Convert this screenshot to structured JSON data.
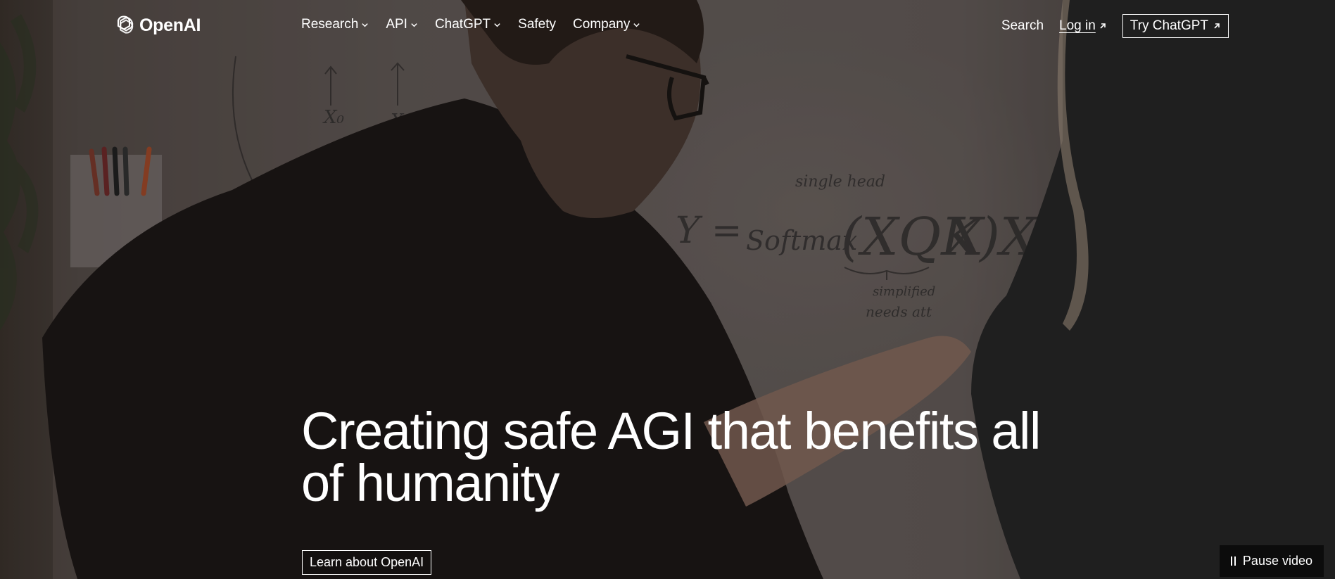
{
  "brand": {
    "name": "OpenAI"
  },
  "nav": {
    "items": [
      {
        "label": "Research",
        "has_dropdown": true
      },
      {
        "label": "API",
        "has_dropdown": true
      },
      {
        "label": "ChatGPT",
        "has_dropdown": true
      },
      {
        "label": "Safety",
        "has_dropdown": false
      },
      {
        "label": "Company",
        "has_dropdown": true
      }
    ],
    "search_label": "Search",
    "login_label": "Log in",
    "try_label": "Try ChatGPT"
  },
  "hero": {
    "headline": "Creating safe AGI that benefits all of humanity",
    "cta_label": "Learn about OpenAI",
    "pause_label": "Pause video"
  },
  "icons": {
    "logo": "openai-logo-icon",
    "dropdown": "chevron-down-icon",
    "external": "arrow-up-right-icon",
    "pause": "pause-icon"
  }
}
